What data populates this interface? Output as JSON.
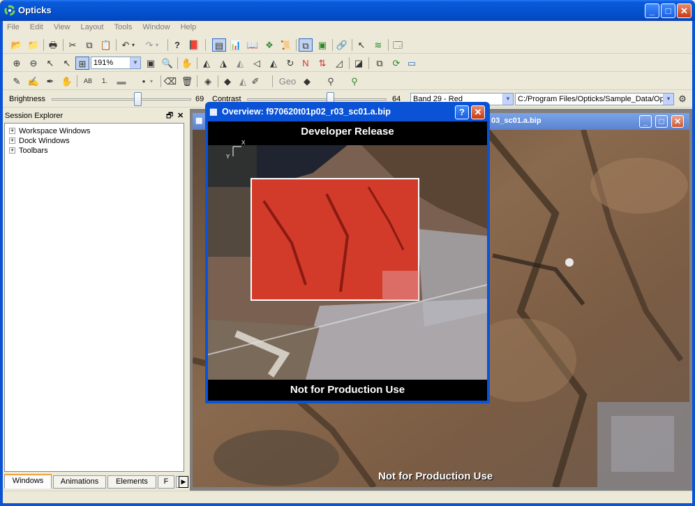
{
  "window": {
    "title": "Opticks",
    "controls": [
      "minimize",
      "maximize",
      "close"
    ]
  },
  "menu": [
    "File",
    "Edit",
    "View",
    "Layout",
    "Tools",
    "Window",
    "Help"
  ],
  "toolbar": {
    "zoom_value": "191%",
    "geo_label": "Geo",
    "text_tool_label": "AB",
    "number_tool_label": "1.",
    "north_label": "N"
  },
  "adjustments": {
    "brightness_label": "Brightness",
    "brightness_value": "69",
    "brightness_level": 0.62,
    "contrast_label": "Contrast",
    "contrast_value": "64",
    "contrast_level": 0.6,
    "band_value": "Band 29 - Red",
    "path_value": "C:/Program Files/Opticks/Sample_Data/Ope"
  },
  "session_explorer": {
    "title": "Session Explorer",
    "items": [
      {
        "label": "Workspace Windows"
      },
      {
        "label": "Dock Windows"
      },
      {
        "label": "Toolbars"
      }
    ],
    "tabs": [
      {
        "label": "Windows",
        "active": true
      },
      {
        "label": "Animations",
        "active": false
      },
      {
        "label": "Elements",
        "active": false
      },
      {
        "label": "F",
        "active": false
      }
    ]
  },
  "image_window": {
    "title_visible": "03_sc01.a.bip",
    "overlay_bottom": "Not for Production Use"
  },
  "overview": {
    "title": "Overview: f970620t01p02_r03_sc01.a.bip",
    "top_caption": "Developer Release",
    "bottom_caption": "Not for Production Use",
    "axis_x": "X",
    "axis_y": "Y"
  },
  "colors": {
    "titlebar": "#0453d0",
    "selection_highlight": "#d23a2a",
    "terrain_brown": "#8a6a4e"
  }
}
